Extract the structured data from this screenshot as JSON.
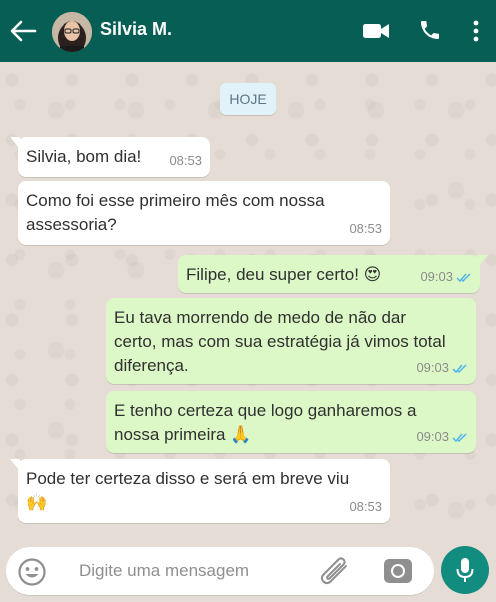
{
  "header": {
    "contact_name": "Silvia M.",
    "back_icon": "arrow-left-icon",
    "video_icon": "video-call-icon",
    "call_icon": "phone-icon",
    "menu_icon": "more-vertical-icon",
    "bg_color": "#075e54"
  },
  "chat": {
    "date_label": "HOJE",
    "messages": [
      {
        "direction": "in",
        "text": "Silvia, bom dia!",
        "time": "08:53"
      },
      {
        "direction": "in",
        "line1": "Como foi esse primeiro mês com nossa",
        "line2": "assessoria?",
        "time": "08:53"
      },
      {
        "direction": "out",
        "text": "Filipe, deu super certo! 😍",
        "time": "09:03",
        "status": "read"
      },
      {
        "direction": "out",
        "line1": "Eu tava morrendo de medo de não dar",
        "line2": "certo, mas com sua estratégia já vimos total",
        "line3": "diferença.",
        "time": "09:03",
        "status": "read"
      },
      {
        "direction": "out",
        "line1": "E tenho certeza que logo ganharemos a",
        "line2": "nossa primeira 🙏",
        "time": "09:03",
        "status": "read"
      },
      {
        "direction": "in",
        "line1": "Pode ter certeza disso e será em breve viu",
        "line2": "🙌",
        "time": "08:53"
      }
    ]
  },
  "footer": {
    "placeholder": "Digite uma mensagem",
    "emoji_icon": "emoji-icon",
    "attach_icon": "paperclip-icon",
    "camera_icon": "camera-icon",
    "mic_icon": "microphone-icon"
  }
}
